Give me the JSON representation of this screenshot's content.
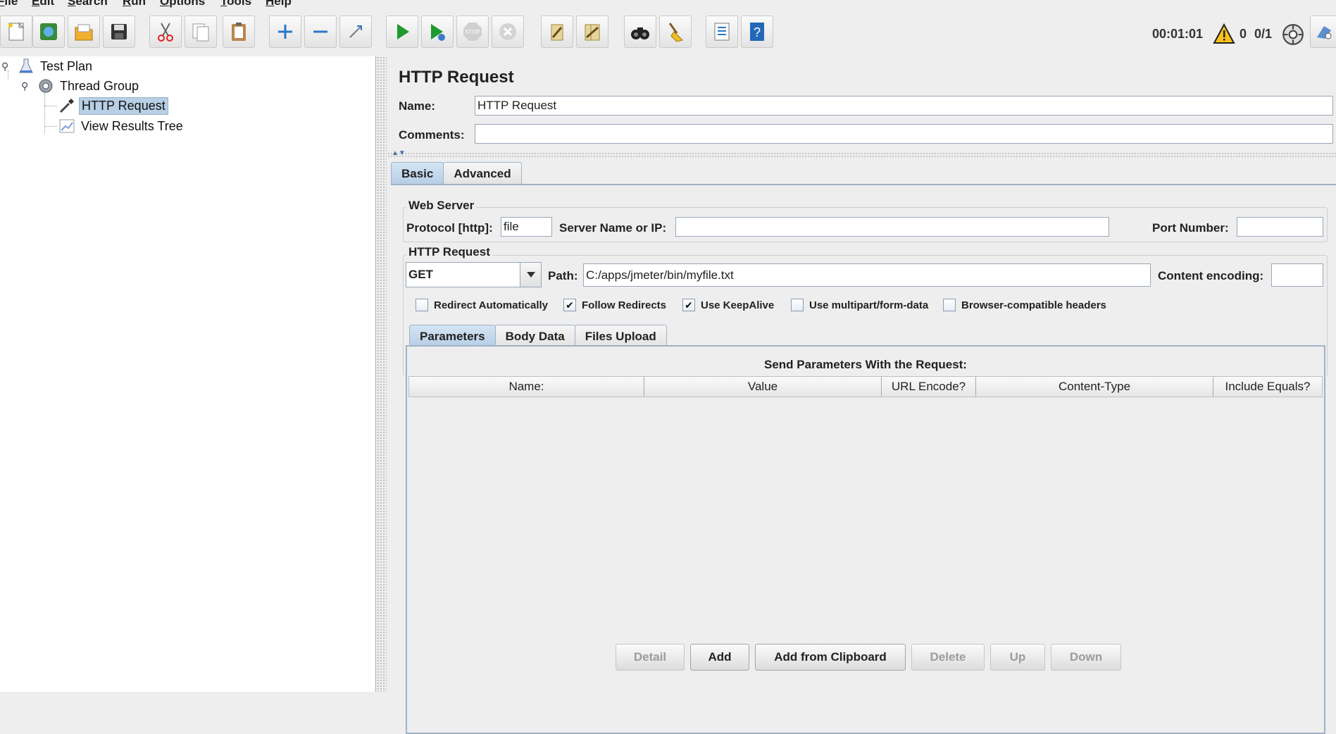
{
  "menu": [
    "File",
    "Edit",
    "Search",
    "Run",
    "Options",
    "Tools",
    "Help"
  ],
  "toolbar": {
    "buttons": [
      "new-icon",
      "templates-icon",
      "open-icon",
      "save-icon",
      "cut-icon",
      "copy-icon",
      "paste-icon",
      "expand-icon",
      "collapse-icon",
      "toggle-icon",
      "start-icon",
      "start-no-pauses-icon",
      "stop-icon",
      "shutdown-icon",
      "clear-icon",
      "clear-all-icon",
      "search-icon",
      "reset-search-icon",
      "function-helper-icon",
      "help-icon"
    ],
    "elapsed": "00:01:01",
    "warnings": "0",
    "threads": "0/1"
  },
  "tree": {
    "items": [
      "Test Plan",
      "Thread Group",
      "HTTP Request",
      "View Results Tree"
    ],
    "selected": "HTTP Request"
  },
  "panel": {
    "title": "HTTP Request",
    "name_label": "Name:",
    "name_value": "HTTP Request",
    "comments_label": "Comments:",
    "comments_value": "",
    "tabs": [
      "Basic",
      "Advanced"
    ],
    "active_tab": "Basic"
  },
  "web_server": {
    "title": "Web Server",
    "protocol_label": "Protocol [http]:",
    "protocol_value": "file",
    "server_label": "Server Name or IP:",
    "server_value": "",
    "port_label": "Port Number:",
    "port_value": ""
  },
  "http_request": {
    "title": "HTTP Request",
    "method": "GET",
    "path_label": "Path:",
    "path_value": "C:/apps/jmeter/bin/myfile.txt",
    "encoding_label": "Content encoding:",
    "encoding_value": "",
    "checkboxes": [
      {
        "label": "Redirect Automatically",
        "checked": false
      },
      {
        "label": "Follow Redirects",
        "checked": true
      },
      {
        "label": "Use KeepAlive",
        "checked": true
      },
      {
        "label": "Use multipart/form-data",
        "checked": false
      },
      {
        "label": "Browser-compatible headers",
        "checked": false
      }
    ]
  },
  "params": {
    "tabs": [
      "Parameters",
      "Body Data",
      "Files Upload"
    ],
    "active_tab": "Parameters",
    "title": "Send Parameters With the Request:",
    "columns": [
      "Name:",
      "Value",
      "URL Encode?",
      "Content-Type",
      "Include Equals?"
    ],
    "buttons": [
      {
        "label": "Detail",
        "enabled": false
      },
      {
        "label": "Add",
        "enabled": true
      },
      {
        "label": "Add from Clipboard",
        "enabled": true
      },
      {
        "label": "Delete",
        "enabled": false
      },
      {
        "label": "Up",
        "enabled": false
      },
      {
        "label": "Down",
        "enabled": false
      }
    ]
  }
}
